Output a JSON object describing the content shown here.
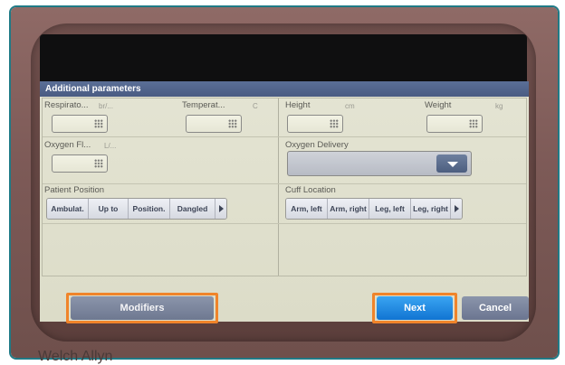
{
  "dialog": {
    "title": "Additional parameters"
  },
  "fields": {
    "respiration": {
      "label": "Respirato...",
      "unit": "br/..."
    },
    "temperature": {
      "label": "Temperat...",
      "unit": "C"
    },
    "height": {
      "label": "Height",
      "unit": "cm"
    },
    "weight": {
      "label": "Weight",
      "unit": "kg"
    },
    "oxygen_flow": {
      "label": "Oxygen Fl...",
      "unit": "L/..."
    },
    "oxygen_delivery": {
      "label": "Oxygen Delivery"
    }
  },
  "patient_position": {
    "label": "Patient Position",
    "options": [
      "Ambulat.",
      "Up to",
      "Position.",
      "Dangled"
    ]
  },
  "cuff_location": {
    "label": "Cuff Location",
    "options": [
      "Arm, left",
      "Arm, right",
      "Leg, left",
      "Leg, right"
    ]
  },
  "footer": {
    "modifiers": "Modifiers",
    "next": "Next",
    "cancel": "Cancel"
  },
  "brand": "Welch Allyn",
  "colors": {
    "titlebar": "#4f6189",
    "next_button": "#1a8be0",
    "highlight": "#f0842a",
    "bezel": "#7d5a57"
  }
}
